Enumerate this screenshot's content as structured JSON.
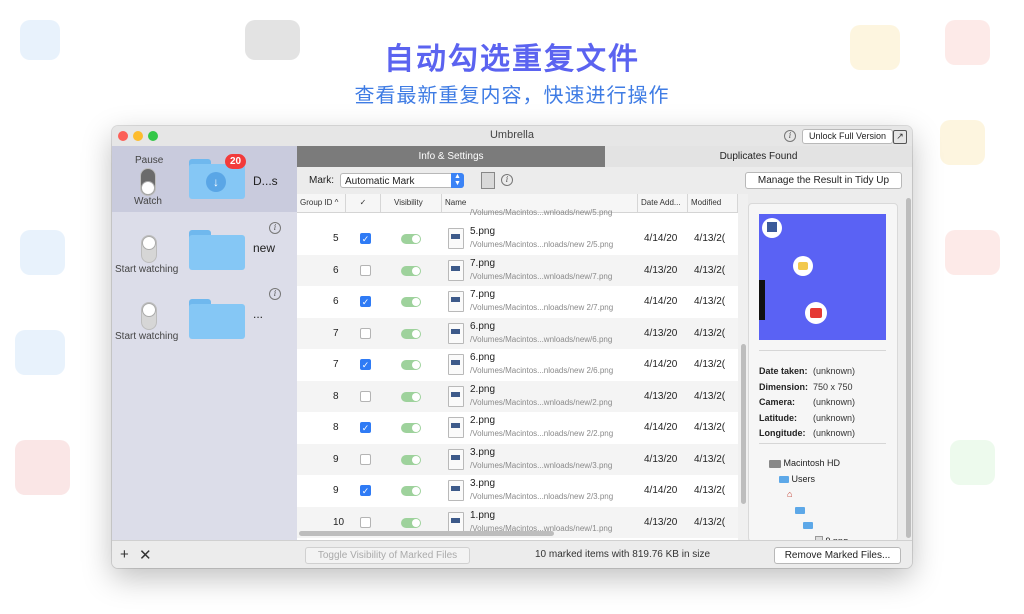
{
  "promo": {
    "headline": "自动勾选重复文件",
    "subheadline": "查看最新重复内容，快速进行操作"
  },
  "window": {
    "title": "Umbrella",
    "unlock_label": "Unlock Full Version"
  },
  "sidebar": {
    "items": [
      {
        "toggle_label_top": "Pause",
        "toggle_label_bottom": "Watch",
        "badge": "20",
        "name": "D...s",
        "toggle_on": true
      },
      {
        "toggle_label_bottom": "Start watching",
        "name": "new",
        "toggle_on": false
      },
      {
        "toggle_label_bottom": "Start watching",
        "name": "...",
        "toggle_on": false
      }
    ]
  },
  "tabs": [
    {
      "label": "Info & Settings",
      "active": true
    },
    {
      "label": "Duplicates Found",
      "active": false
    }
  ],
  "toolbar": {
    "mark_label": "Mark:",
    "mark_value": "Automatic Mark",
    "manage_button": "Manage the Result in Tidy Up"
  },
  "table": {
    "columns": [
      "Group ID ^",
      "✓",
      "Visibility",
      "Name",
      "Date Add...",
      "Modified"
    ],
    "top_partial_path": "/Volumes/Macintos...wnloads/new/5.png",
    "rows": [
      {
        "group": "5",
        "checked": true,
        "name": "5.png",
        "path": "/Volumes/Macintos...nloads/new 2/5.png",
        "added": "4/14/20",
        "modified": "4/13/2("
      },
      {
        "group": "6",
        "checked": false,
        "name": "7.png",
        "path": "/Volumes/Macintos...wnloads/new/7.png",
        "added": "4/13/20",
        "modified": "4/13/2("
      },
      {
        "group": "6",
        "checked": true,
        "name": "7.png",
        "path": "/Volumes/Macintos...nloads/new 2/7.png",
        "added": "4/14/20",
        "modified": "4/13/2("
      },
      {
        "group": "7",
        "checked": false,
        "name": "6.png",
        "path": "/Volumes/Macintos...wnloads/new/6.png",
        "added": "4/13/20",
        "modified": "4/13/2("
      },
      {
        "group": "7",
        "checked": true,
        "name": "6.png",
        "path": "/Volumes/Macintos...nloads/new 2/6.png",
        "added": "4/14/20",
        "modified": "4/13/2("
      },
      {
        "group": "8",
        "checked": false,
        "name": "2.png",
        "path": "/Volumes/Macintos...wnloads/new/2.png",
        "added": "4/13/20",
        "modified": "4/13/2("
      },
      {
        "group": "8",
        "checked": true,
        "name": "2.png",
        "path": "/Volumes/Macintos...nloads/new 2/2.png",
        "added": "4/14/20",
        "modified": "4/13/2("
      },
      {
        "group": "9",
        "checked": false,
        "name": "3.png",
        "path": "/Volumes/Macintos...wnloads/new/3.png",
        "added": "4/13/20",
        "modified": "4/13/2("
      },
      {
        "group": "9",
        "checked": true,
        "name": "3.png",
        "path": "/Volumes/Macintos...nloads/new 2/3.png",
        "added": "4/14/20",
        "modified": "4/13/2("
      },
      {
        "group": "10",
        "checked": false,
        "name": "1.png",
        "path": "/Volumes/Macintos...wnloads/new/1.png",
        "added": "4/13/20",
        "modified": "4/13/2("
      }
    ]
  },
  "info": {
    "meta": [
      {
        "key": "Date taken:",
        "value": "(unknown)"
      },
      {
        "key": "Dimension:",
        "value": "750 x 750"
      },
      {
        "key": "Camera:",
        "value": "(unknown)"
      },
      {
        "key": "Latitude:",
        "value": "(unknown)"
      },
      {
        "key": "Longitude:",
        "value": "(unknown)"
      }
    ],
    "path_tree": [
      {
        "label": "Macintosh HD",
        "icon": "disk-icon"
      },
      {
        "label": "Users",
        "icon": "folder-icon"
      },
      {
        "label": "",
        "icon": "home-icon"
      },
      {
        "label": "",
        "icon": "folder-icon"
      },
      {
        "label": "",
        "icon": "folder-icon"
      },
      {
        "label": "9.png",
        "icon": "file-icon"
      }
    ]
  },
  "bottom": {
    "toggle_visibility_label": "Toggle Visibility of Marked Files",
    "status": "10 marked items with 819.76 KB in size",
    "remove_button": "Remove Marked Files..."
  },
  "colors": {
    "headline": "#5b63f0",
    "subheadline": "#3f7ce4",
    "accent": "#2f7bf5",
    "badge": "#f23b3b",
    "preview_bg": "#5a62f4"
  }
}
